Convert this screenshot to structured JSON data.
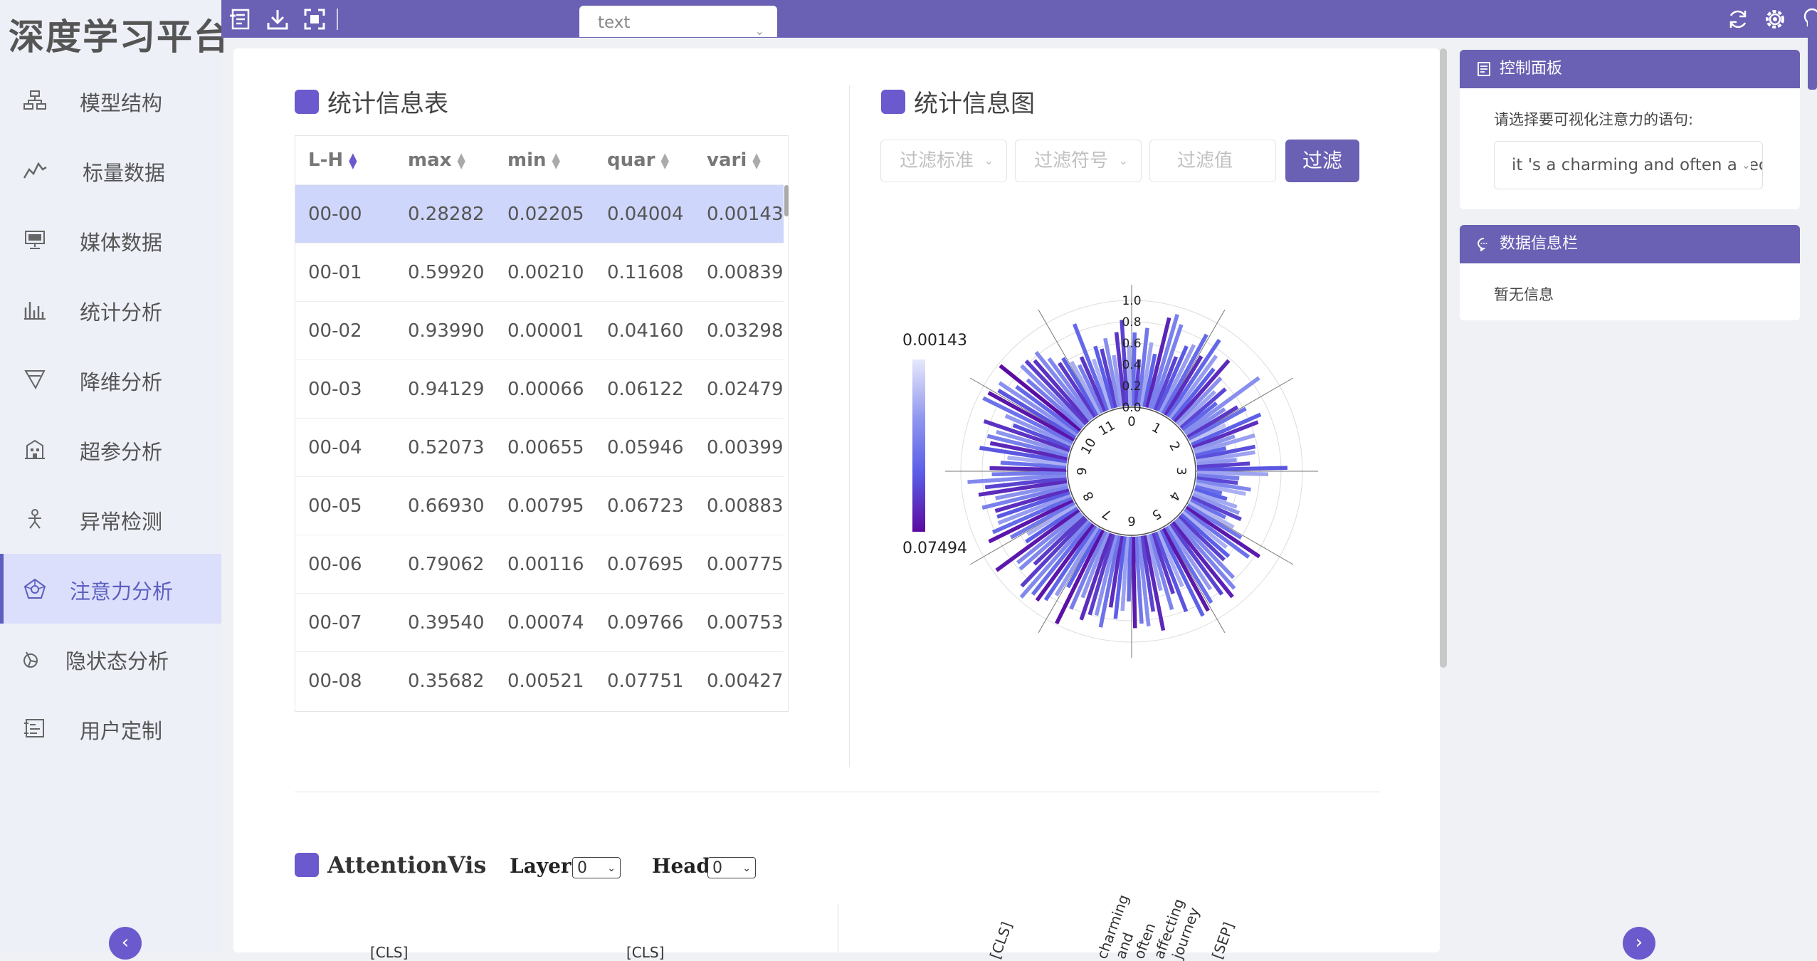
{
  "app": {
    "logo": "深度学习平台"
  },
  "sidebar": {
    "items": [
      {
        "label": "模型结构",
        "icon": "model-structure-icon",
        "active": false
      },
      {
        "label": "标量数据",
        "icon": "line-chart-icon",
        "active": false
      },
      {
        "label": "媒体数据",
        "icon": "monitor-icon",
        "active": false
      },
      {
        "label": "统计分析",
        "icon": "bar-chart-icon",
        "active": false
      },
      {
        "label": "降维分析",
        "icon": "funnel-icon",
        "active": false
      },
      {
        "label": "超参分析",
        "icon": "building-icon",
        "active": false
      },
      {
        "label": "异常检测",
        "icon": "person-icon",
        "active": false
      },
      {
        "label": "注意力分析",
        "icon": "attention-icon",
        "active": true
      },
      {
        "label": "隐状态分析",
        "icon": "hidden-state-icon",
        "active": false
      },
      {
        "label": "用户定制",
        "icon": "custom-icon",
        "active": false
      }
    ]
  },
  "topbar": {
    "select_value": "text",
    "icons": [
      "export-icon",
      "download-icon",
      "fullscreen-icon",
      "refresh-icon",
      "settings-icon",
      "lightbulb-icon"
    ]
  },
  "stats_table": {
    "title": "统计信息表",
    "columns": [
      "L-H",
      "max",
      "min",
      "quar",
      "vari"
    ],
    "rows": [
      [
        "00-00",
        "0.28282",
        "0.02205",
        "0.04004",
        "0.00143"
      ],
      [
        "00-01",
        "0.59920",
        "0.00210",
        "0.11608",
        "0.00839"
      ],
      [
        "00-02",
        "0.93990",
        "0.00001",
        "0.04160",
        "0.03298"
      ],
      [
        "00-03",
        "0.94129",
        "0.00066",
        "0.06122",
        "0.02479"
      ],
      [
        "00-04",
        "0.52073",
        "0.00655",
        "0.05946",
        "0.00399"
      ],
      [
        "00-05",
        "0.66930",
        "0.00795",
        "0.06723",
        "0.00883"
      ],
      [
        "00-06",
        "0.79062",
        "0.00116",
        "0.07695",
        "0.00775"
      ],
      [
        "00-07",
        "0.39540",
        "0.00074",
        "0.09766",
        "0.00753"
      ],
      [
        "00-08",
        "0.35682",
        "0.00521",
        "0.07751",
        "0.00427"
      ]
    ]
  },
  "stats_chart": {
    "title": "统计信息图",
    "filter": {
      "criterion_placeholder": "过滤标准",
      "operator_placeholder": "过滤符号",
      "value_placeholder": "过滤值",
      "button_label": "过滤"
    },
    "colorbar": {
      "min_label": "0.00143",
      "max_label": "0.07494",
      "colors": [
        "#e6e8fb",
        "#8e95ee",
        "#5b5fe8",
        "#5b0aa0"
      ]
    }
  },
  "chart_data": {
    "type": "bar",
    "polar": true,
    "radial_ticks": [
      "0.0",
      "0.2",
      "0.4",
      "0.6",
      "0.8",
      "1.0"
    ],
    "ylim": [
      0,
      1
    ],
    "categories": [
      "0",
      "1",
      "2",
      "3",
      "4",
      "5",
      "6",
      "7",
      "8",
      "9",
      "10",
      "11"
    ],
    "series": [
      {
        "values": [
          0.7,
          0.45,
          0.75,
          0.62,
          0.52,
          0.88,
          0.93,
          0.85,
          0.55,
          0.68,
          0.72,
          0.86,
          0.66,
          0.88,
          0.74,
          0.63,
          0.78,
          0.61,
          0.48,
          0.57,
          0.42,
          0.88,
          0.45,
          0.56,
          0.62,
          0.38,
          0.72,
          0.67,
          0.42,
          0.6,
          0.31,
          0.58,
          0.57,
          0.39,
          0.51,
          0.86,
          0.68,
          0.41,
          0.4,
          0.53,
          0.49,
          0.27,
          0.33,
          0.44,
          0.48,
          0.52,
          0.38,
          0.49,
          0.6,
          0.84,
          0.76,
          0.54,
          0.61,
          0.6,
          0.78,
          0.86,
          0.91,
          0.83,
          0.73,
          0.84,
          0.89,
          0.91,
          0.58,
          0.81,
          0.61,
          0.75,
          0.55,
          0.92,
          0.73,
          0.86,
          0.83,
          0.87,
          0.62,
          0.71,
          0.79,
          0.69,
          0.89,
          0.79,
          0.8,
          0.87,
          0.67,
          0.81,
          0.99,
          0.64,
          0.76,
          0.85,
          0.9,
          0.88,
          0.97,
          0.89,
          0.66,
          0.79,
          0.77,
          0.97,
          0.59,
          0.54,
          0.69,
          0.89,
          0.82,
          0.74,
          0.73,
          0.73,
          0.84,
          0.7,
          0.85,
          0.78,
          0.94,
          0.71,
          0.73,
          0.63,
          0.57,
          0.84,
          0.75,
          0.79,
          0.72,
          0.86,
          0.59,
          0.69,
          0.95,
          0.93,
          0.86,
          0.89,
          0.74,
          0.98,
          0.7,
          0.83,
          0.83,
          0.78,
          0.83,
          0.71,
          0.62,
          0.64,
          0.57,
          0.51,
          0.57,
          0.88,
          0.51,
          0.62,
          0.58,
          0.67,
          0.5,
          0.71,
          0.82,
          0.58
        ]
      }
    ]
  },
  "attention_vis": {
    "title": "AttentionVis",
    "layer_label": "Layer:",
    "layer_value": "0",
    "head_label": "Head:",
    "head_value": "0",
    "left_tokens": [
      "[CLS]",
      "[CLS]"
    ],
    "right_tokens": [
      "[CLS]",
      "charming",
      "and",
      "often",
      "affecting",
      "journey",
      "[SEP]"
    ]
  },
  "control_panel": {
    "title": "控制面板",
    "prompt": "请选择要可视化注意力的语句:",
    "sentence_value": "it 's a charming and often affecting journey"
  },
  "info_panel": {
    "title": "数据信息栏",
    "empty_text": "暂无信息"
  }
}
